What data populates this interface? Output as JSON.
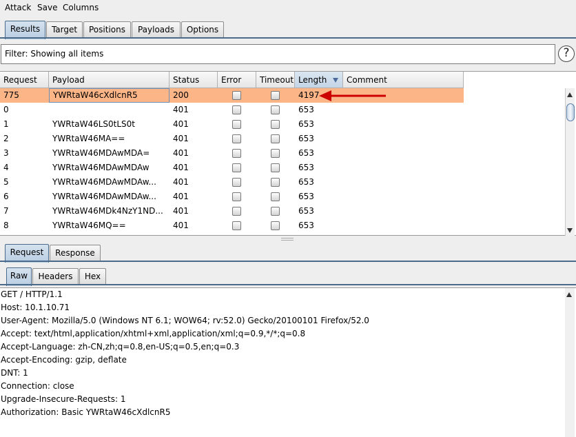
{
  "menu": {
    "items": [
      "Attack",
      "Save",
      "Columns"
    ]
  },
  "main_tabs": {
    "items": [
      "Results",
      "Target",
      "Positions",
      "Payloads",
      "Options"
    ],
    "active": "Results"
  },
  "filter": {
    "text": "Filter: Showing all items",
    "help_label": "?"
  },
  "table": {
    "columns": [
      "Request",
      "Payload",
      "Status",
      "Error",
      "Timeout",
      "Length",
      "Comment"
    ],
    "sorted_column": "Length",
    "rows": [
      {
        "request": "775",
        "payload": "YWRtaW46cXdlcnR5",
        "status": "200",
        "length": "4197",
        "comment": "",
        "selected": true
      },
      {
        "request": "0",
        "payload": "",
        "status": "401",
        "length": "653",
        "comment": ""
      },
      {
        "request": "1",
        "payload": "YWRtaW46LS0tLS0t",
        "status": "401",
        "length": "653",
        "comment": ""
      },
      {
        "request": "2",
        "payload": "YWRtaW46MA==",
        "status": "401",
        "length": "653",
        "comment": ""
      },
      {
        "request": "3",
        "payload": "YWRtaW46MDAwMDA=",
        "status": "401",
        "length": "653",
        "comment": ""
      },
      {
        "request": "4",
        "payload": "YWRtaW46MDAwMDAw",
        "status": "401",
        "length": "653",
        "comment": ""
      },
      {
        "request": "5",
        "payload": "YWRtaW46MDAwMDAw...",
        "status": "401",
        "length": "653",
        "comment": ""
      },
      {
        "request": "6",
        "payload": "YWRtaW46MDAwMDAw...",
        "status": "401",
        "length": "653",
        "comment": ""
      },
      {
        "request": "7",
        "payload": "YWRtaW46MDk4NzY1ND...",
        "status": "401",
        "length": "653",
        "comment": ""
      },
      {
        "request": "8",
        "payload": "YWRtaW46MQ==",
        "status": "401",
        "length": "653",
        "comment": ""
      }
    ]
  },
  "detail_tabs": {
    "items": [
      "Request",
      "Response"
    ],
    "active": "Request"
  },
  "view_tabs": {
    "items": [
      "Raw",
      "Headers",
      "Hex"
    ],
    "active": "Raw"
  },
  "raw_request": {
    "lines": [
      "GET / HTTP/1.1",
      "Host: 10.1.10.71",
      "User-Agent: Mozilla/5.0 (Windows NT 6.1; WOW64; rv:52.0) Gecko/20100101 Firefox/52.0",
      "Accept: text/html,application/xhtml+xml,application/xml;q=0.9,*/*;q=0.8",
      "Accept-Language: zh-CN,zh;q=0.8,en-US;q=0.5,en;q=0.3",
      "Accept-Encoding: gzip, deflate",
      "DNT: 1",
      "Connection: close",
      "Upgrade-Insecure-Requests: 1",
      "Authorization: Basic YWRtaW46cXdlcnR5"
    ]
  },
  "colors": {
    "selected_row": "#fbb587",
    "annotation_arrow": "#cc0000",
    "tab_active": "#c3d4e6"
  }
}
